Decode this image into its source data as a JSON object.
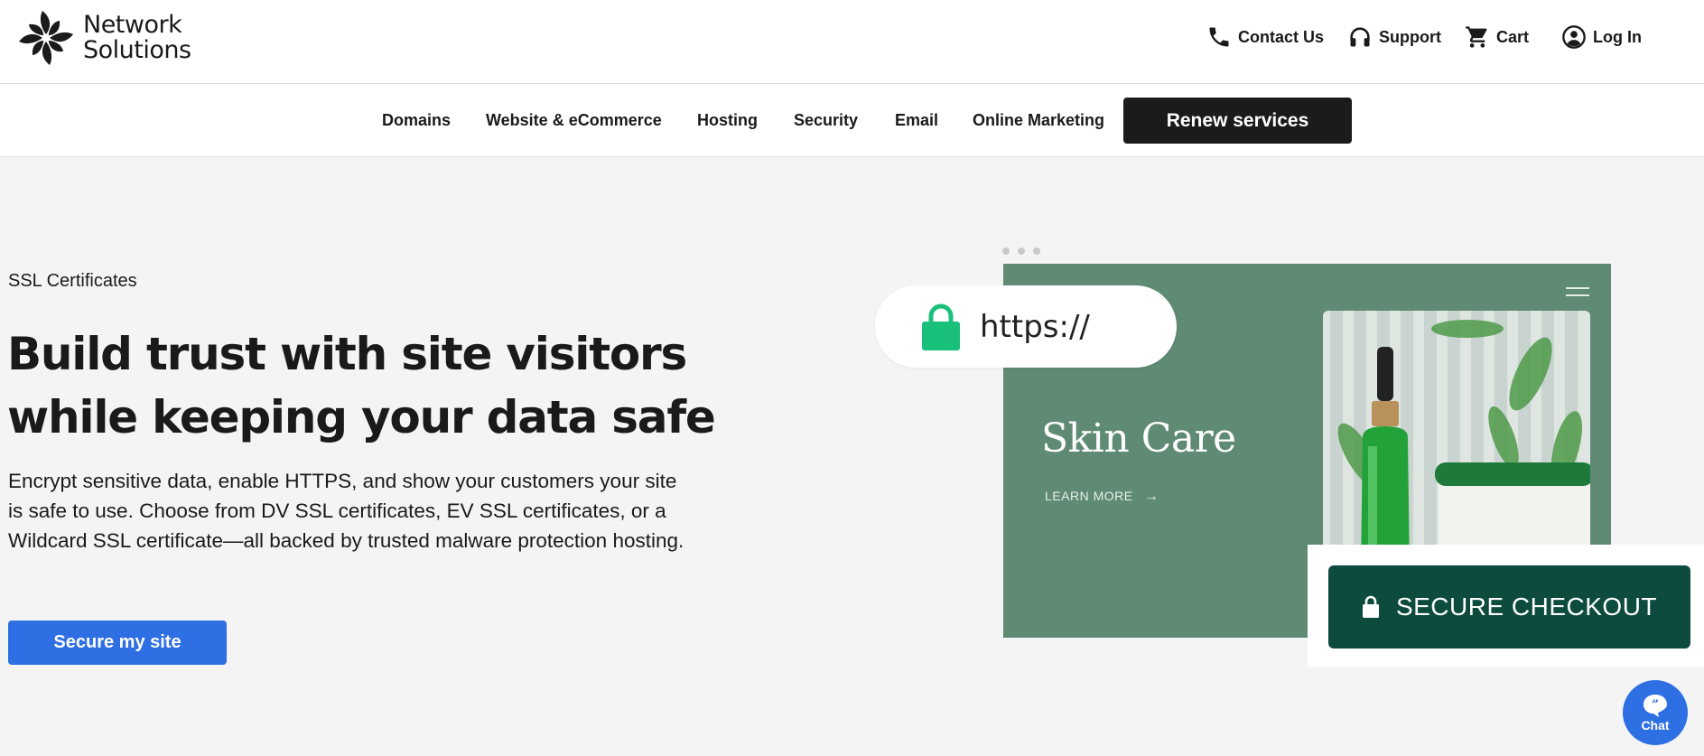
{
  "brand": {
    "line1": "Network",
    "line2": "Solutions"
  },
  "utility_nav": {
    "contact": "Contact Us",
    "support": "Support",
    "cart": "Cart",
    "login": "Log In"
  },
  "main_nav": {
    "items": [
      "Domains",
      "Website & eCommerce",
      "Hosting",
      "Security",
      "Email",
      "Online Marketing"
    ],
    "renew": "Renew services"
  },
  "hero": {
    "eyebrow": "SSL Certificates",
    "headline_line1": "Build trust with site visitors",
    "headline_line2": "while keeping your data safe",
    "description": "Encrypt sensitive data, enable HTTPS, and show your customers your site is safe to use. Choose from DV SSL certificates, EV SSL certificates, or a Wildcard SSL certificate—all backed by trusted malware protection hosting.",
    "cta": "Secure my site"
  },
  "illustration": {
    "https": "https://",
    "site_title": "Skin Care",
    "learn_more": "LEARN MORE",
    "secure_checkout": "SECURE CHECKOUT"
  },
  "chat": {
    "label": "Chat"
  },
  "colors": {
    "accent_blue": "#2f6fe4",
    "dark": "#1b1b1b",
    "sage": "#5f8a74",
    "checkout_green": "#0d4b3e",
    "lock_green": "#19c07a",
    "page_bg": "#f4f4f4"
  }
}
